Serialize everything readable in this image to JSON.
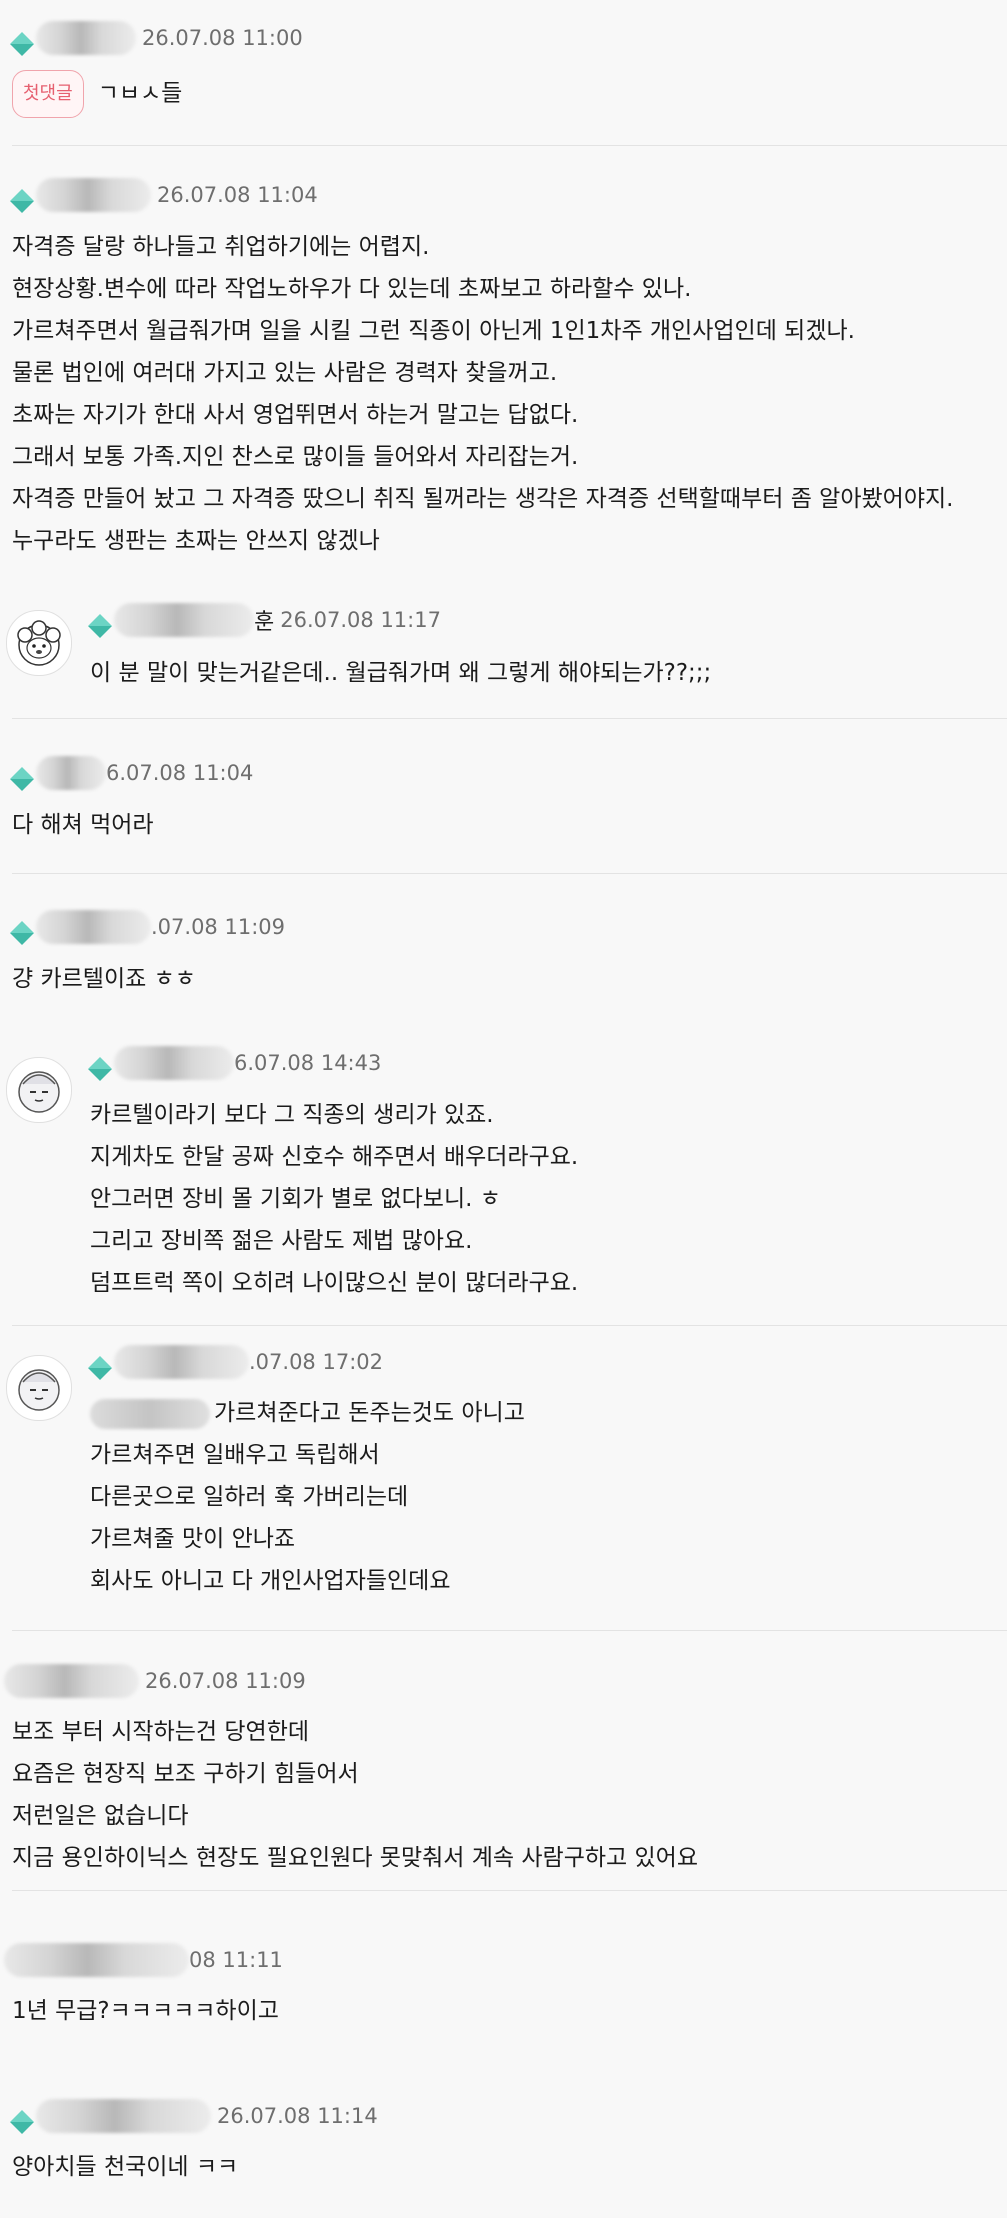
{
  "comments": [
    {
      "time": "26.07.08 11:00",
      "badge": "첫댓글",
      "lines": [
        "ㄱㅂㅅ들"
      ]
    },
    {
      "time": "26.07.08 11:04",
      "lines": [
        "자격증 달랑 하나들고 취업하기에는 어렵지.",
        "현장상황.변수에 따라 작업노하우가 다 있는데 초짜보고 하라할수 있나.",
        "가르쳐주면서 월급줘가며 일을 시킬 그런 직종이 아닌게 1인1차주 개인사업인데 되겠나.",
        "물론 법인에 여러대 가지고 있는 사람은 경력자 찾을꺼고.",
        "초짜는 자기가 한대 사서 영업뛰면서 하는거 말고는 답없다.",
        "그래서 보통 가족.지인 찬스로 많이들 들어와서 자리잡는거.",
        "자격증 만들어 놨고 그 자격증 땄으니 취직 될꺼라는 생각은 자격증 선택할때부터 좀 알아봤어야지.",
        "누구라도 생판는 초짜는 안쓰지 않겠나"
      ]
    },
    {
      "reply": true,
      "nick_suffix": "훈",
      "time": "26.07.08 11:17",
      "lines": [
        "이 분 말이 맞는거같은데.. 월급줘가며 왜 그렇게 해야되는가??;;;"
      ]
    },
    {
      "time": "26.07.08 11:04",
      "time_display": "6.07.08 11:04",
      "lines": [
        "다 해쳐 먹어라"
      ]
    },
    {
      "time": "26.07.08 11:09",
      "time_display": ".07.08 11:09",
      "lines": [
        "걍 카르텔이죠 ㅎㅎ"
      ]
    },
    {
      "reply": true,
      "time": "26.07.08 14:43",
      "time_display": "6.07.08 14:43",
      "lines": [
        "카르텔이라기 보다 그 직종의 생리가 있죠.",
        "지게차도 한달 공짜 신호수 해주면서 배우더라구요.",
        "안그러면 장비 몰 기회가 별로 없다보니. ㅎ",
        "그리고 장비쪽 젊은 사람도 제법 많아요.",
        "덤프트럭 쪽이 오히려 나이많으신 분이 많더라구요."
      ]
    },
    {
      "reply": true,
      "time": "26.07.08 17:02",
      "time_display": ".07.08 17:02",
      "lines": [
        "가르쳐준다고 돈주는것도 아니고",
        "가르쳐주면 일배우고 독립해서",
        "다른곳으로 일하러 훅 가버리는데",
        "가르쳐줄 맛이 안나죠",
        "회사도 아니고 다 개인사업자들인데요"
      ]
    },
    {
      "time": "26.07.08 11:09",
      "lines": [
        "보조 부터 시작하는건 당연한데",
        "요즘은 현장직 보조 구하기 힘들어서",
        "저런일은 없습니다",
        "지금 용인하이닉스 현장도 필요인원다 못맞춰서 계속 사람구하고 있어요"
      ]
    },
    {
      "time": "26.07.08 11:11",
      "time_display": "08 11:11",
      "lines": [
        "1년 무급?ㅋㅋㅋㅋㅋ하이고"
      ]
    },
    {
      "time": "26.07.08 11:14",
      "lines": [
        "양아치들 천국이네 ㅋㅋ"
      ]
    }
  ],
  "colors": {
    "background": "#f8f8f8",
    "badge": "#e66070",
    "timestamp": "#6e6e6e",
    "grade_icon": "#3fb8a6"
  }
}
